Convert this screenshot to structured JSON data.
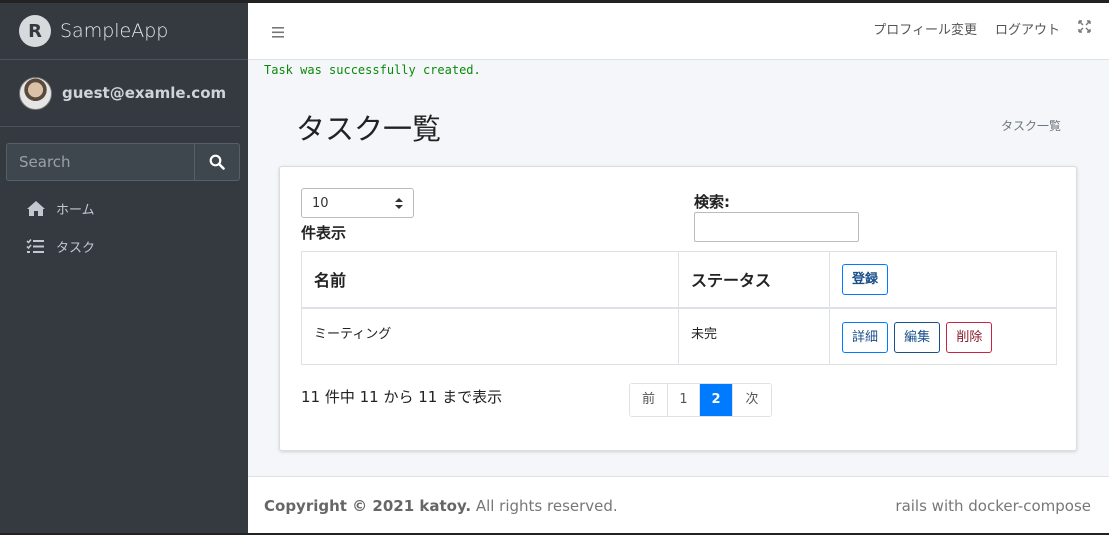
{
  "sidebar": {
    "brand": "SampleApp",
    "brand_logo_letter": "R",
    "user": "guest@examle.com",
    "search_placeholder": "Search",
    "nav": [
      {
        "label": "ホーム",
        "icon": "home-icon"
      },
      {
        "label": "タスク",
        "icon": "tasks-icon"
      }
    ]
  },
  "header": {
    "menu_icon": "hamburger-icon",
    "profile_link": "プロフィール変更",
    "logout_link": "ログアウト",
    "fullscreen_icon": "expand-icon"
  },
  "flash": "Task was successfully created.",
  "page": {
    "title": "タスク一覧",
    "breadcrumb": "タスク一覧"
  },
  "table_controls": {
    "per_page_value": "10",
    "per_page_label": "件表示",
    "search_label": "検索:"
  },
  "table": {
    "headers": [
      "名前",
      "ステータス"
    ],
    "register_button": "登録",
    "rows": [
      {
        "name": "ミーティング",
        "status": "未完",
        "detail": "詳細",
        "edit": "編集",
        "delete": "削除"
      }
    ]
  },
  "pagination": {
    "info": "11 件中 11 から 11 まで表示",
    "prev": "前",
    "pages": [
      "1",
      "2"
    ],
    "active": "2",
    "next": "次"
  },
  "footer": {
    "copyright_prefix": "Copyright © 2021 katoy.",
    "copyright_suffix": " All rights reserved.",
    "right": "rails with docker-compose"
  },
  "colors": {
    "sidebar_bg": "#343a40",
    "primary": "#007bff",
    "danger": "#c82340",
    "success_text": "#0a8a0a"
  }
}
